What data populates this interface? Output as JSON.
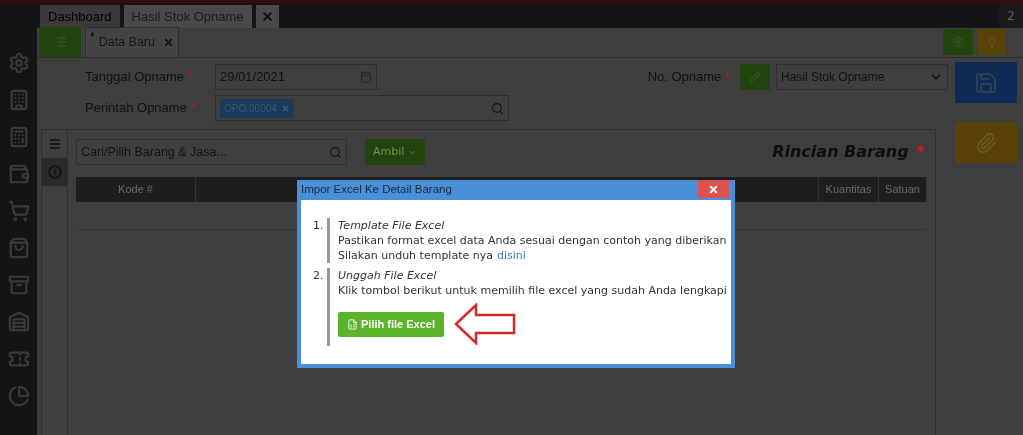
{
  "top_tabs": [
    {
      "label": "Dashboard",
      "selected": false
    },
    {
      "label": "Hasil Stok Opname",
      "selected": true
    }
  ],
  "top_counter": "2",
  "doc_tab": {
    "label": "Data Baru",
    "modified_mark": "*"
  },
  "form": {
    "tanggal_label": "Tanggal Opname",
    "tanggal_value": "29/01/2021",
    "perintah_label": "Perintah Opname",
    "perintah_tag": "OPO.00004",
    "no_label": "No. Opname",
    "no_value": "Hasil Stok Opname",
    "required_mark": "*"
  },
  "detail": {
    "search_placeholder": "Cari/Pilih Barang & Jasa...",
    "ambil_button": "Ambil",
    "title": "Rincian Barang",
    "required_mark": "*",
    "columns": [
      "Kode #",
      "",
      "Kuantitas",
      "Satuan"
    ]
  },
  "side_tabs": [
    {
      "kind": "list",
      "selected": true
    },
    {
      "kind": "info",
      "selected": false
    }
  ],
  "dialog": {
    "title": "Impor Excel Ke Detail Barang",
    "steps": [
      {
        "number": "1.",
        "title": "Template File Excel",
        "lines": [
          "Pastikan format excel data Anda sesuai dengan contoh yang diberikan"
        ],
        "link_prefix": "Silakan unduh template nya",
        "link": "disini"
      },
      {
        "number": "2.",
        "title": "Unggah File Excel",
        "lines": [
          "Klik tombol berikut untuk memilih file excel yang sudah Anda lengkapi"
        ],
        "button": "Pilih file Excel"
      }
    ]
  }
}
